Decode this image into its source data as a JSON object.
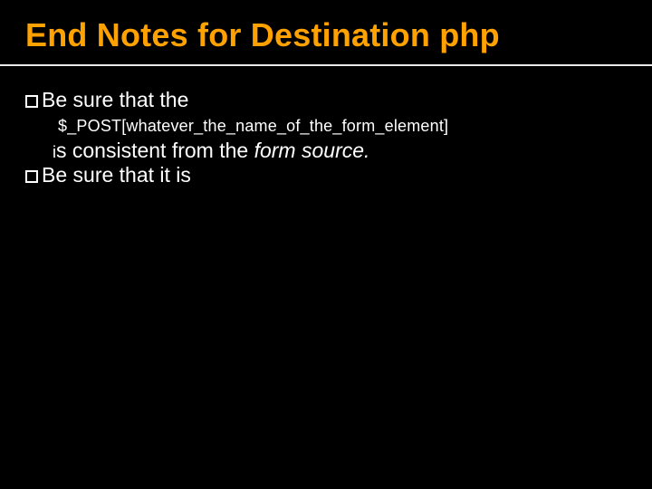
{
  "title": "End Notes for Destination php",
  "bullets": {
    "b1_lead": "Be sure that the",
    "code": "$_POST[whatever_the_name_of_the_form_element]",
    "cont_prefix": "i",
    "cont_text_1": "s consistent from the ",
    "cont_italic": "form source.",
    "b2_text": "Be sure that it is"
  }
}
